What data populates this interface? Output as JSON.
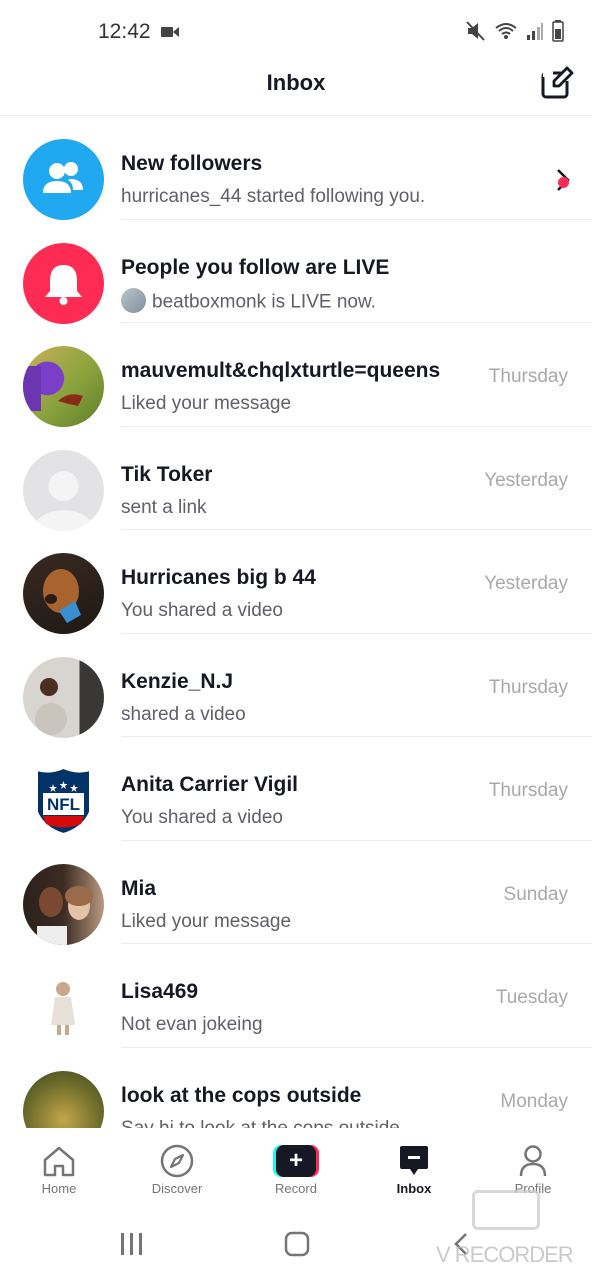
{
  "status_bar": {
    "time": "12:42"
  },
  "header": {
    "title": "Inbox"
  },
  "rows": [
    {
      "title": "New followers",
      "subtitle": "hurricanes_44 started following you.",
      "time": ""
    },
    {
      "title": "People you follow are LIVE",
      "subtitle": "beatboxmonk is LIVE now.",
      "time": ""
    },
    {
      "title": "mauvemult&chqlxturtle=queens",
      "subtitle": "Liked your message",
      "time": "Thursday"
    },
    {
      "title": "Tik Toker",
      "subtitle": "sent a link",
      "time": "Yesterday"
    },
    {
      "title": "Hurricanes big b 44",
      "subtitle": "You shared a video",
      "time": "Yesterday"
    },
    {
      "title": "Kenzie_N.J",
      "subtitle": "shared a video",
      "time": "Thursday"
    },
    {
      "title": "Anita Carrier Vigil",
      "subtitle": "You shared a video",
      "time": "Thursday"
    },
    {
      "title": "Mia",
      "subtitle": "Liked your message",
      "time": "Sunday"
    },
    {
      "title": "Lisa469",
      "subtitle": "Not evan jokeing",
      "time": "Tuesday"
    },
    {
      "title": "look at the cops outside",
      "subtitle": "Say hi to look at the cops outside",
      "time": "Monday"
    }
  ],
  "nav": {
    "home": "Home",
    "discover": "Discover",
    "record": "Record",
    "inbox": "Inbox",
    "profile": "Profile"
  },
  "logo_text": "NFL",
  "watermark": "V RECORDER",
  "colors": {
    "accent_blue": "#20a8f0",
    "accent_red": "#fe2c55",
    "accent_cyan": "#25f4ee",
    "text_primary": "#161823",
    "text_secondary": "#5f6068",
    "text_time": "#a8a9ad"
  }
}
